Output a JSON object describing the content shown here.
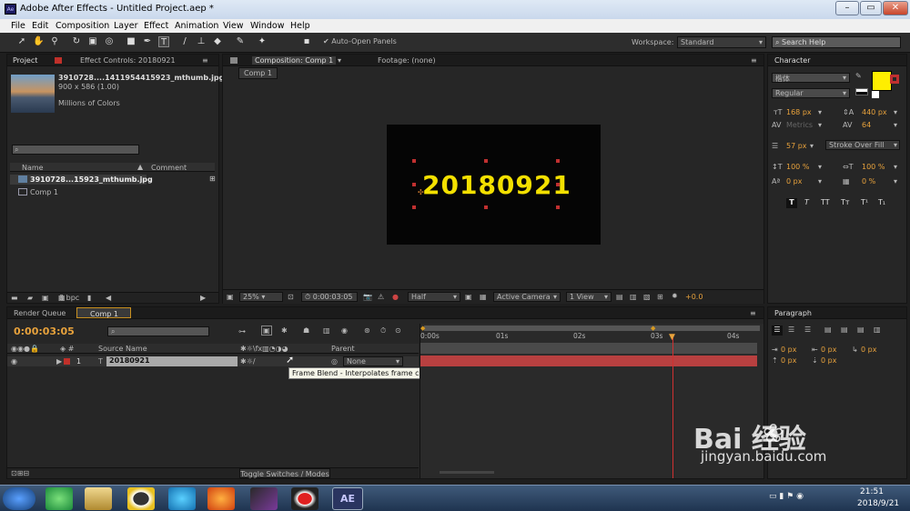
{
  "app": {
    "title": "Adobe After Effects - Untitled Project.aep *",
    "icon_label": "Ae",
    "window_controls": [
      "minimize-icon",
      "maximize-icon",
      "close-icon"
    ]
  },
  "menu": [
    "File",
    "Edit",
    "Composition",
    "Layer",
    "Effect",
    "Animation",
    "View",
    "Window",
    "Help"
  ],
  "toolbar": {
    "auto_open": "Auto-Open Panels",
    "workspace_label": "Workspace:",
    "workspace_value": "Standard",
    "search_placeholder": "Search Help"
  },
  "project": {
    "tab_project": "Project",
    "tab_effect": "Effect Controls: 20180921",
    "file_name": "3910728....1411954415923_mthumb.jpg ▾",
    "file_dims": "900 x 586 (1.00)",
    "file_colors": "Millions of Colors",
    "col_name": "Name",
    "col_comment": "Comment",
    "items": [
      "3910728...15923_mthumb.jpg",
      "Comp 1"
    ],
    "bpc": "8 bpc"
  },
  "composition": {
    "tab_label": "Composition: Comp 1",
    "footage_label": "Footage: (none)",
    "sub_tab": "Comp 1",
    "text": "20180921",
    "zoom": "25%",
    "timecode": "0:00:03:05",
    "quality": "Half",
    "camera": "Active Camera",
    "view": "1 View",
    "exposure": "+0.0"
  },
  "character": {
    "tab": "Character",
    "font_family": "楷体",
    "font_style": "Regular",
    "font_size": "168 px",
    "leading": "440 px",
    "kerning": "Metrics",
    "tracking": "64",
    "stroke_width": "57 px",
    "stroke_mode": "Stroke Over Fill",
    "vscale": "100 %",
    "hscale": "100 %",
    "baseline": "0 px",
    "tsume": "0 %",
    "fill_color": "#ffee00",
    "styles": [
      "T",
      "T",
      "TT",
      "Tт",
      "T¹",
      "T₁"
    ]
  },
  "paragraph": {
    "tab": "Paragraph",
    "indents": [
      "0 px",
      "0 px",
      "0 px",
      "0 px",
      "0 px"
    ]
  },
  "timeline": {
    "tab_render": "Render Queue",
    "tab_comp": "Comp 1",
    "timecode": "0:00:03:05",
    "col_source": "Source Name",
    "col_parent": "Parent",
    "layer_num": "1",
    "layer_name": "20180921",
    "parent_value": "None",
    "ruler": [
      "0:00s",
      "01s",
      "02s",
      "03s",
      "04s"
    ],
    "tooltip": "Frame Blend - Interpolates frame content by weighted blending",
    "toggle": "Toggle Switches / Modes"
  },
  "watermark": {
    "brand": "Bai  经验",
    "url": "jingyan.baidu.com"
  },
  "taskbar": {
    "time": "21:51",
    "date": "2018/9/21",
    "ae_label": "AE"
  }
}
